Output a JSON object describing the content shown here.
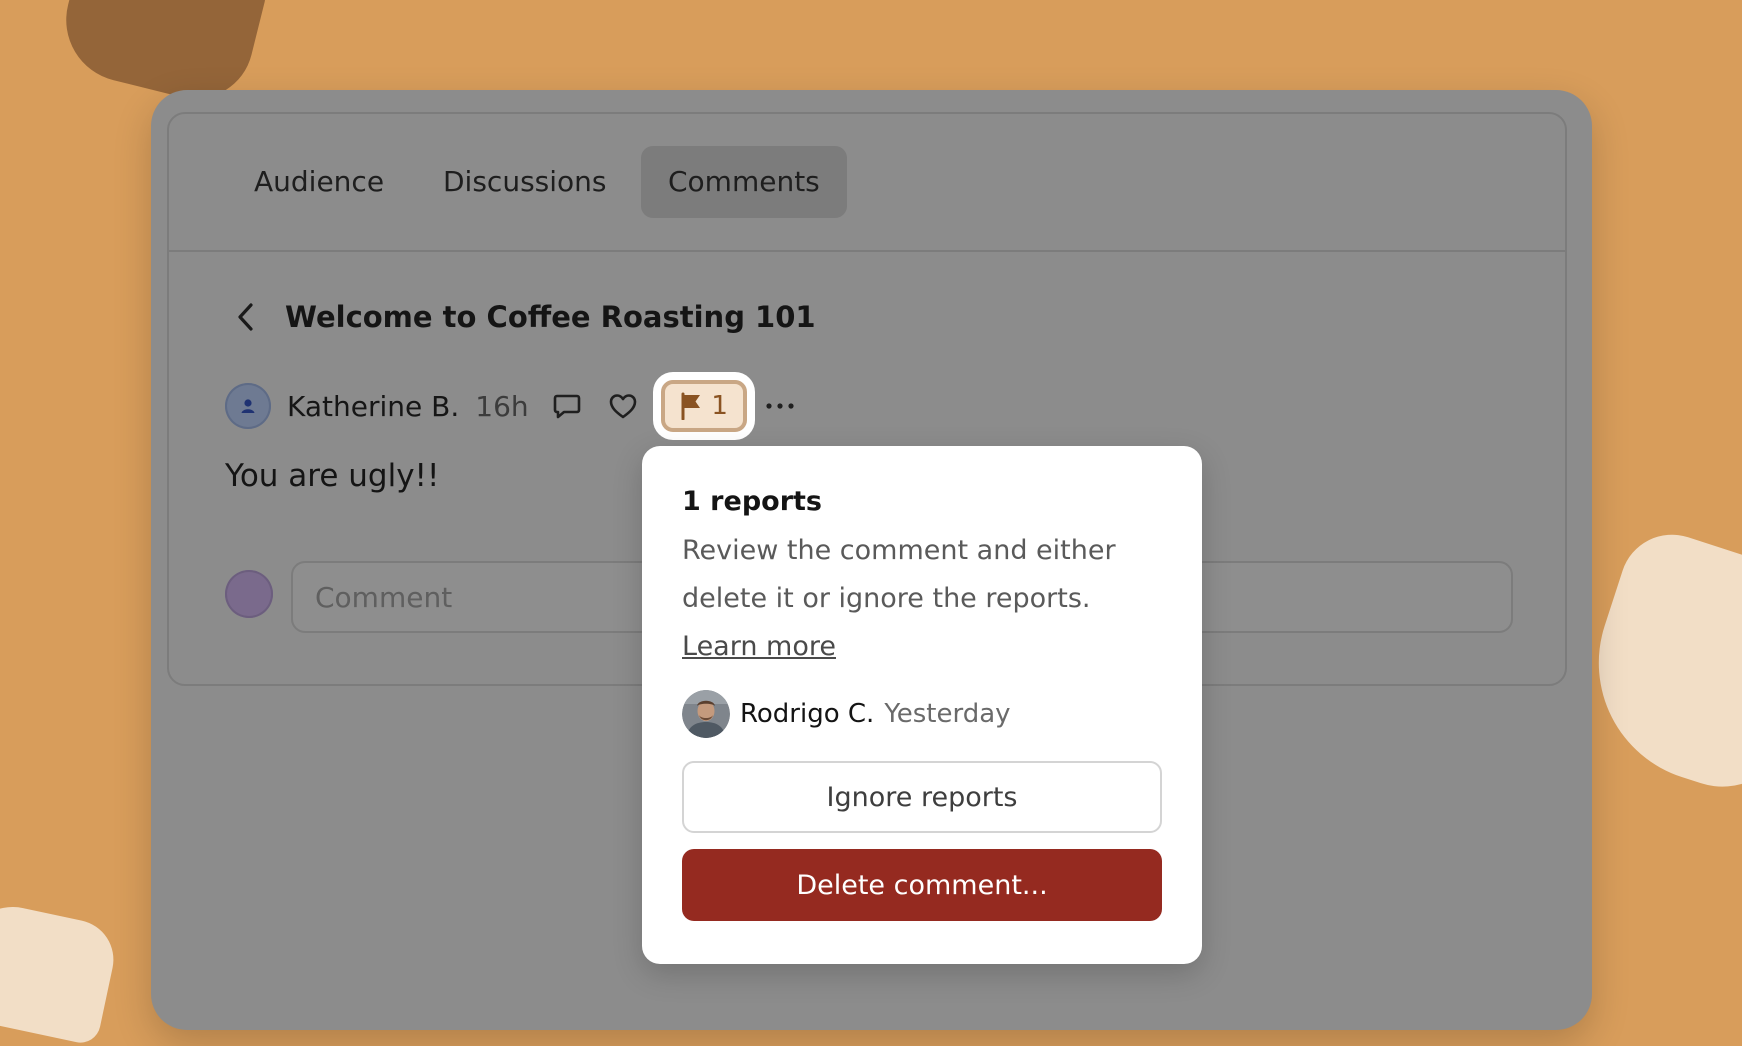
{
  "tabs": [
    {
      "label": "Audience"
    },
    {
      "label": "Discussions"
    },
    {
      "label": "Comments",
      "active": true
    }
  ],
  "thread": {
    "title": "Welcome to Coffee Roasting 101"
  },
  "comment": {
    "author": "Katherine B.",
    "time": "16h",
    "body": "You are ugly!!",
    "report_count": "1"
  },
  "composer": {
    "placeholder": "Comment"
  },
  "popover": {
    "title": "1 reports",
    "description": "Review the comment and either delete it or ignore the reports.",
    "link_text": "Learn more",
    "reporter": {
      "name": "Rodrigo C.",
      "time": "Yesterday"
    },
    "ignore_label": "Ignore reports",
    "delete_label": "Delete comment..."
  },
  "colors": {
    "background": "#D89D5B",
    "overlay_window": "#8C8C8C",
    "delete_button": "#952A20",
    "flag_badge": "#F5E3CF",
    "flag_icon": "#8A5322"
  },
  "icons": [
    "back-chevron-icon",
    "user-icon",
    "reply-icon",
    "heart-icon",
    "flag-icon",
    "more-icon"
  ]
}
